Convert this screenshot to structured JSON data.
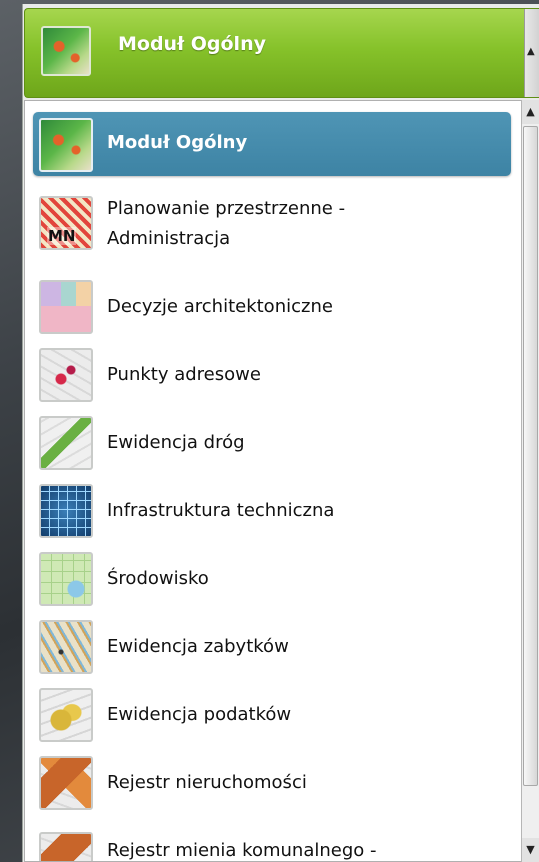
{
  "selected": {
    "label": "Moduł Ogólny",
    "icon": "modul-ogolny-icon"
  },
  "scroll": {
    "up_arrow": "▲",
    "down_arrow": "▼"
  },
  "colors": {
    "header_green": "#86c22a",
    "selected_blue": "#3d83a4"
  },
  "items": [
    {
      "line1": "Moduł Ogólny",
      "line2": "",
      "icon": "modul-ogolny-icon"
    },
    {
      "line1": "Planowanie przestrzenne -",
      "line2": "Administracja",
      "icon": "planowanie-icon",
      "icon_text": "MN"
    },
    {
      "line1": "Decyzje architektoniczne",
      "line2": "",
      "icon": "decyzje-icon"
    },
    {
      "line1": "Punkty adresowe",
      "line2": "",
      "icon": "punkty-adresowe-icon"
    },
    {
      "line1": "Ewidencja dróg",
      "line2": "",
      "icon": "ewidencja-drog-icon"
    },
    {
      "line1": "Infrastruktura techniczna",
      "line2": "",
      "icon": "infrastruktura-icon"
    },
    {
      "line1": "Środowisko",
      "line2": "",
      "icon": "srodowisko-icon"
    },
    {
      "line1": "Ewidencja zabytków",
      "line2": "",
      "icon": "zabytki-icon"
    },
    {
      "line1": "Ewidencja podatków",
      "line2": "",
      "icon": "podatki-icon"
    },
    {
      "line1": "Rejestr nieruchomości",
      "line2": "",
      "icon": "nieruchomosci-icon"
    },
    {
      "line1": "Rejestr mienia komunalnego -",
      "line2": "",
      "icon": "mienie-icon"
    }
  ]
}
